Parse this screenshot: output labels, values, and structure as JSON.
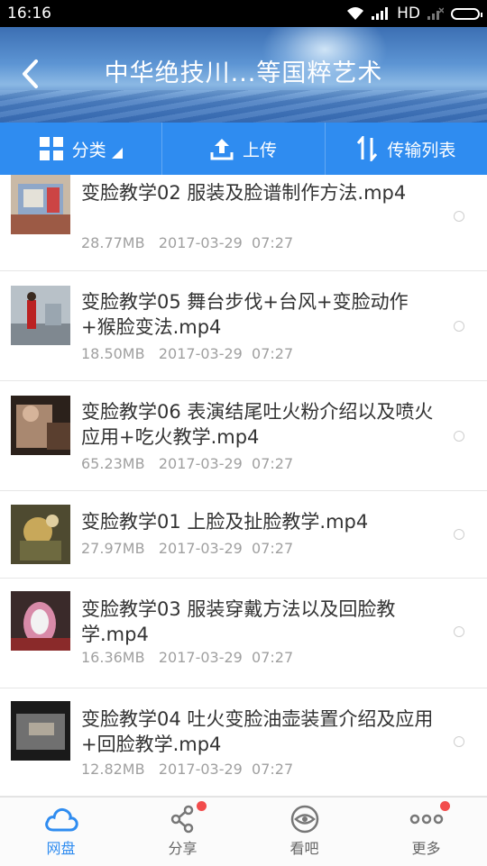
{
  "statusbar": {
    "time": "16:16",
    "network": "HD"
  },
  "header": {
    "title": "中华绝技川...等国粹艺术"
  },
  "toolbar": {
    "category_label": "分类",
    "upload_label": "上传",
    "transfer_label": "传输列表"
  },
  "files": [
    {
      "name": "变脸教学02 服装及脸谱制作方法.mp4",
      "size": "28.77MB",
      "date": "2017-03-29",
      "time": "07:27"
    },
    {
      "name": "变脸教学05 舞台步伐+台风+变脸动作+猴脸变法.mp4",
      "size": "18.50MB",
      "date": "2017-03-29",
      "time": "07:27"
    },
    {
      "name": "变脸教学06 表演结尾吐火粉介绍以及喷火应用+吃火教学.mp4",
      "size": "65.23MB",
      "date": "2017-03-29",
      "time": "07:27"
    },
    {
      "name": "变脸教学01 上脸及扯脸教学.mp4",
      "size": "27.97MB",
      "date": "2017-03-29",
      "time": "07:27"
    },
    {
      "name": "变脸教学03 服装穿戴方法以及回脸教学.mp4",
      "size": "16.36MB",
      "date": "2017-03-29",
      "time": "07:27"
    },
    {
      "name": "变脸教学04 吐火变脸油壶装置介绍及应用+回脸教学.mp4",
      "size": "12.82MB",
      "date": "2017-03-29",
      "time": "07:27"
    }
  ],
  "bottomnav": {
    "items": [
      {
        "label": "网盘",
        "icon": "cloud-icon",
        "active": true
      },
      {
        "label": "分享",
        "icon": "share-icon",
        "badge": true
      },
      {
        "label": "看吧",
        "icon": "eye-icon"
      },
      {
        "label": "更多",
        "icon": "more-dots-icon",
        "badge": true
      }
    ]
  },
  "colors": {
    "accent": "#2f8cf0",
    "badge": "#f24c4c"
  }
}
